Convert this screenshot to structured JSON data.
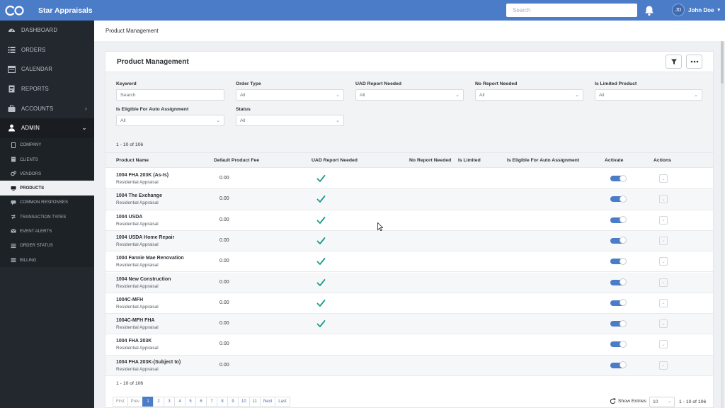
{
  "header": {
    "brand": "Star Appraisals",
    "search_placeholder": "Search",
    "user_initials": "JD",
    "user_name": "John Doe"
  },
  "sidebar": {
    "items": [
      {
        "label": "DASHBOARD",
        "icon": "dashboard-icon"
      },
      {
        "label": "ORDERS",
        "icon": "list-icon"
      },
      {
        "label": "CALENDAR",
        "icon": "calendar-icon"
      },
      {
        "label": "REPORTS",
        "icon": "report-icon"
      },
      {
        "label": "ACCOUNTS",
        "icon": "briefcase-icon"
      },
      {
        "label": "ADMIN",
        "icon": "user-icon"
      }
    ],
    "sub_items": [
      {
        "label": "COMPANY"
      },
      {
        "label": "CLIENTS"
      },
      {
        "label": "VENDORS"
      },
      {
        "label": "PRODUCTS"
      },
      {
        "label": "COMMON RESPONSES"
      },
      {
        "label": "TRANSACTION TYPES"
      },
      {
        "label": "EVENT ALERTS"
      },
      {
        "label": "ORDER STATUS"
      },
      {
        "label": "BILLING"
      }
    ]
  },
  "breadcrumb": "Product Management",
  "card": {
    "title": "Product Management"
  },
  "filters": {
    "keyword": {
      "label": "Keyword",
      "placeholder": "Search"
    },
    "order_type": {
      "label": "Order Type",
      "value": "All"
    },
    "uad_report": {
      "label": "UAD Report Needed",
      "value": "All"
    },
    "no_report": {
      "label": "No Report Needed",
      "value": "All"
    },
    "limited": {
      "label": "Is Limited Product",
      "value": "All"
    },
    "eligible": {
      "label": "Is Eligible For Auto Assignment",
      "value": "All"
    },
    "status": {
      "label": "Status",
      "value": "All"
    }
  },
  "range_text": "1 - 10 of 106",
  "table": {
    "columns": {
      "name": "Product Name",
      "fee": "Default Product Fee",
      "uad": "UAD Report Needed",
      "no_report": "No Report Needed",
      "limited": "Is Limited",
      "eligible": "Is Eligible For Auto Assignment",
      "activate": "Activate",
      "actions": "Actions"
    },
    "rows": [
      {
        "name": "1004 FHA 203K (As-Is)",
        "type": "Residential Appraisal",
        "fee": "0.00",
        "uad": true,
        "active": true
      },
      {
        "name": "1004 The Exchange",
        "type": "Residential Appraisal",
        "fee": "0.00",
        "uad": true,
        "active": true
      },
      {
        "name": "1004 USDA",
        "type": "Residential Appraisal",
        "fee": "0.00",
        "uad": true,
        "active": true
      },
      {
        "name": "1004 USDA Home Repair",
        "type": "Residential Appraisal",
        "fee": "0.00",
        "uad": true,
        "active": true
      },
      {
        "name": "1004 Fannie Mae Renovation",
        "type": "Residential Appraisal",
        "fee": "0.00",
        "uad": true,
        "active": true
      },
      {
        "name": "1004 New Construction",
        "type": "Residential Appraisal",
        "fee": "0.00",
        "uad": true,
        "active": true
      },
      {
        "name": "1004C-MFH",
        "type": "Residential Appraisal",
        "fee": "0.00",
        "uad": true,
        "active": true
      },
      {
        "name": "1004C-MFH FHA",
        "type": "Residential Appraisal",
        "fee": "0.00",
        "uad": true,
        "active": true
      },
      {
        "name": "1004 FHA 203K",
        "type": "Residential Appraisal",
        "fee": "0.00",
        "uad": false,
        "active": true
      },
      {
        "name": "1004 FHA 203K-(Subject to)",
        "type": "Residential Appraisal",
        "fee": "0.00",
        "uad": false,
        "active": true
      }
    ]
  },
  "pagination": {
    "first": "First",
    "prev": "Prev",
    "pages": [
      "1",
      "2",
      "3",
      "4",
      "5",
      "6",
      "7",
      "8",
      "9",
      "10",
      "11"
    ],
    "current": "1",
    "next": "Next",
    "last": "Last",
    "show_entries": "Show Entries",
    "entries_value": "10"
  },
  "colors": {
    "accent": "#4a7cc7",
    "sidebar": "#23282e",
    "check": "#1a9b8a"
  }
}
